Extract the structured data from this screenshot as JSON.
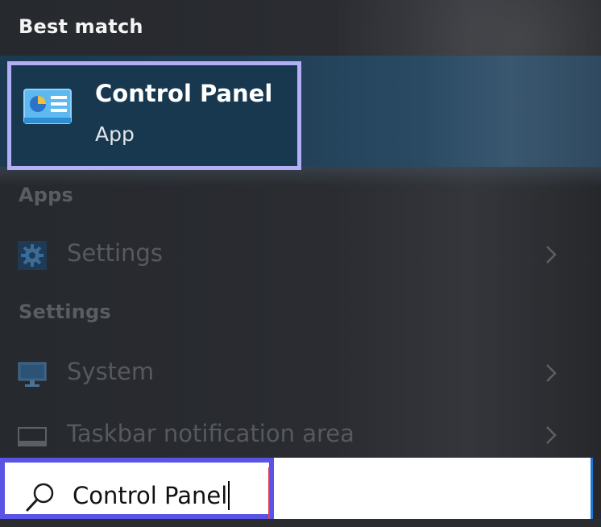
{
  "sections": {
    "best_match": "Best match",
    "apps": "Apps",
    "settings": "Settings"
  },
  "best_match_item": {
    "title": "Control Panel",
    "subtitle": "App",
    "icon": "control-panel-icon"
  },
  "apps_items": [
    {
      "label": "Settings",
      "icon": "gear-icon"
    }
  ],
  "settings_items": [
    {
      "label": "System",
      "icon": "monitor-icon"
    },
    {
      "label": "Taskbar notification area",
      "icon": "taskbar-icon"
    }
  ],
  "search": {
    "value": "Control Panel",
    "icon": "search-icon"
  },
  "colors": {
    "highlight_border": "#b3aef5",
    "search_highlight": "#5a54e6",
    "best_match_bg": "#17384f",
    "accent_blue": "#1e7ad9"
  }
}
